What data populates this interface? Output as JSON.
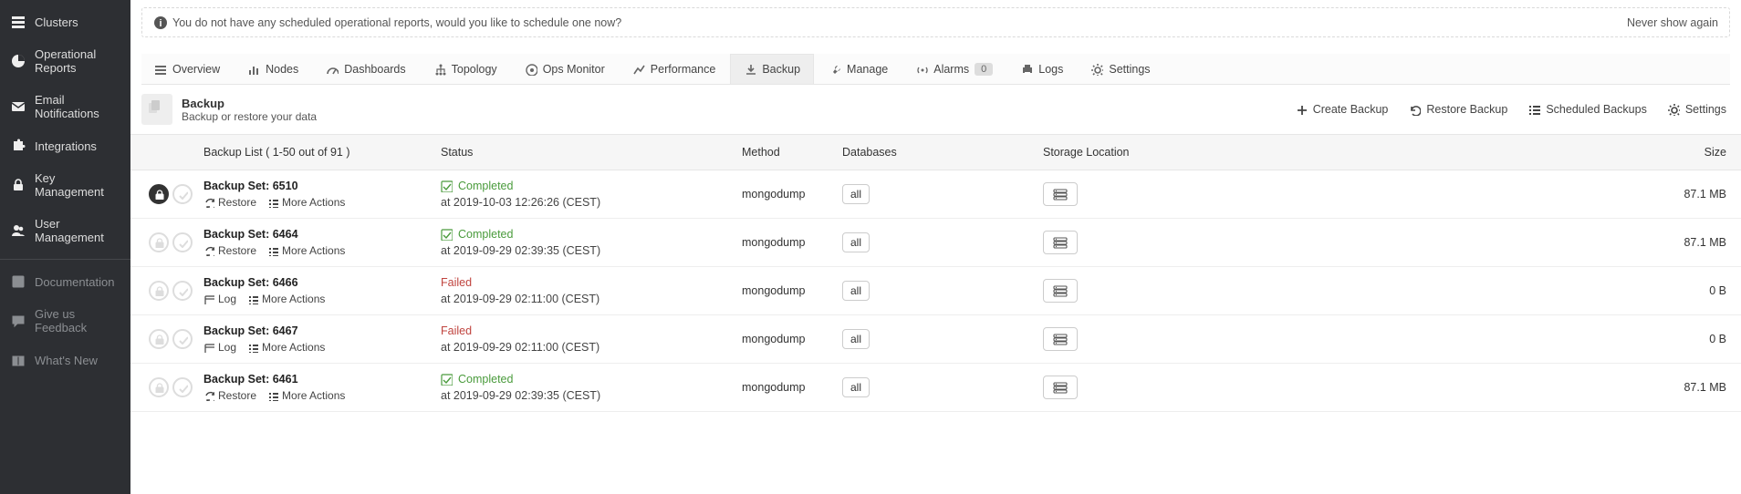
{
  "sidebar": {
    "primary": [
      {
        "label": "Clusters",
        "icon": "stack"
      },
      {
        "label": "Operational Reports",
        "icon": "pie"
      },
      {
        "label": "Email Notifications",
        "icon": "mail"
      },
      {
        "label": "Integrations",
        "icon": "puzzle"
      },
      {
        "label": "Key Management",
        "icon": "lock"
      },
      {
        "label": "User Management",
        "icon": "users"
      }
    ],
    "secondary": [
      {
        "label": "Documentation",
        "icon": "book"
      },
      {
        "label": "Give us Feedback",
        "icon": "chat"
      },
      {
        "label": "What's New",
        "icon": "gift"
      }
    ]
  },
  "notice": {
    "text": "You do not have any scheduled operational reports, would you like to schedule one now?",
    "dismiss": "Never show again"
  },
  "tabs": [
    {
      "label": "Overview",
      "icon": "menu"
    },
    {
      "label": "Nodes",
      "icon": "bars"
    },
    {
      "label": "Dashboards",
      "icon": "gauge"
    },
    {
      "label": "Topology",
      "icon": "tree"
    },
    {
      "label": "Ops Monitor",
      "icon": "target"
    },
    {
      "label": "Performance",
      "icon": "chart"
    },
    {
      "label": "Backup",
      "icon": "download",
      "active": true
    },
    {
      "label": "Manage",
      "icon": "wrench"
    },
    {
      "label": "Alarms",
      "icon": "broadcast",
      "badge": "0"
    },
    {
      "label": "Logs",
      "icon": "printer"
    },
    {
      "label": "Settings",
      "icon": "gear"
    }
  ],
  "page": {
    "title": "Backup",
    "subtitle": "Backup or restore your data",
    "actions": {
      "create": "Create Backup",
      "restore": "Restore Backup",
      "scheduled": "Scheduled Backups",
      "settings": "Settings"
    }
  },
  "table": {
    "headers": {
      "list": "Backup List ( 1-50 out of 91 )",
      "status": "Status",
      "method": "Method",
      "databases": "Databases",
      "storage": "Storage Location",
      "size": "Size"
    },
    "labels": {
      "restore": "Restore",
      "log": "Log",
      "more": "More Actions"
    },
    "rows": [
      {
        "set": "Backup Set: 6510",
        "encrypted": true,
        "status": "Completed",
        "status_type": "completed",
        "time": "at 2019-10-03 12:26:26 (CEST)",
        "method": "mongodump",
        "db": "all",
        "size": "87.1 MB",
        "action": "restore"
      },
      {
        "set": "Backup Set: 6464",
        "encrypted": false,
        "status": "Completed",
        "status_type": "completed",
        "time": "at 2019-09-29 02:39:35 (CEST)",
        "method": "mongodump",
        "db": "all",
        "size": "87.1 MB",
        "action": "restore"
      },
      {
        "set": "Backup Set: 6466",
        "encrypted": false,
        "status": "Failed",
        "status_type": "failed",
        "time": "at 2019-09-29 02:11:00 (CEST)",
        "method": "mongodump",
        "db": "all",
        "size": "0 B",
        "action": "log"
      },
      {
        "set": "Backup Set: 6467",
        "encrypted": false,
        "status": "Failed",
        "status_type": "failed",
        "time": "at 2019-09-29 02:11:00 (CEST)",
        "method": "mongodump",
        "db": "all",
        "size": "0 B",
        "action": "log"
      },
      {
        "set": "Backup Set: 6461",
        "encrypted": false,
        "status": "Completed",
        "status_type": "completed",
        "time": "at 2019-09-29 02:39:35 (CEST)",
        "method": "mongodump",
        "db": "all",
        "size": "87.1 MB",
        "action": "restore"
      }
    ]
  }
}
